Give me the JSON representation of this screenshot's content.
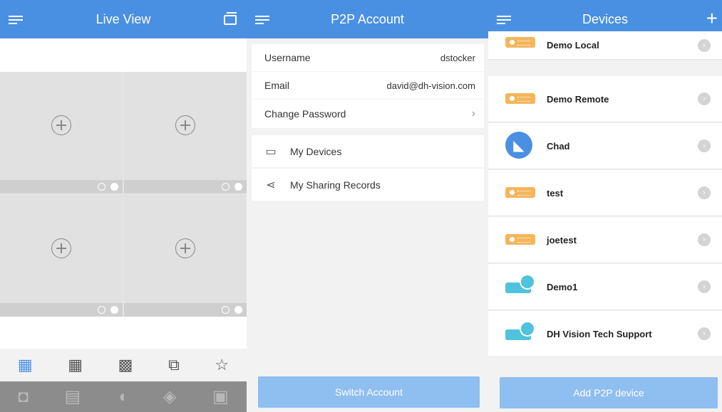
{
  "live_view": {
    "title": "Live View",
    "icons": {
      "menu": "hamburger-icon",
      "window": "window-icon"
    },
    "layout_icons": [
      "grid-4-icon",
      "grid-9-icon",
      "grid-16-icon",
      "switch-window-icon",
      "favorites-star-icon"
    ],
    "tool_icons": [
      "camera-snapshot-icon",
      "record-clapper-icon",
      "audio-icon",
      "ptz-icon",
      "image-icon"
    ]
  },
  "p2p": {
    "title": "P2P Account",
    "username_label": "Username",
    "username_value": "dstocker",
    "email_label": "Email",
    "email_value": "david@dh-vision.com",
    "change_password": "Change Password",
    "my_devices": "My Devices",
    "my_sharing_records": "My Sharing Records",
    "switch_account": "Switch Account"
  },
  "devices": {
    "title": "Devices",
    "items": [
      {
        "name": "Demo Local",
        "icon": "nvr-icon"
      },
      {
        "name": "Demo Remote",
        "icon": "nvr-icon"
      },
      {
        "name": "Chad",
        "icon": "camera-icon"
      },
      {
        "name": "test",
        "icon": "nvr-icon"
      },
      {
        "name": "joetest",
        "icon": "nvr-icon"
      },
      {
        "name": "Demo1",
        "icon": "shared-nvr-icon"
      },
      {
        "name": "DH Vision Tech Support",
        "icon": "cloud-nvr-icon"
      }
    ],
    "add_button": "Add P2P device"
  },
  "colors": {
    "accent": "#4a90e2",
    "button": "#8fbef0",
    "device_orange": "#f4b65b",
    "device_teal": "#4fc2dd"
  }
}
